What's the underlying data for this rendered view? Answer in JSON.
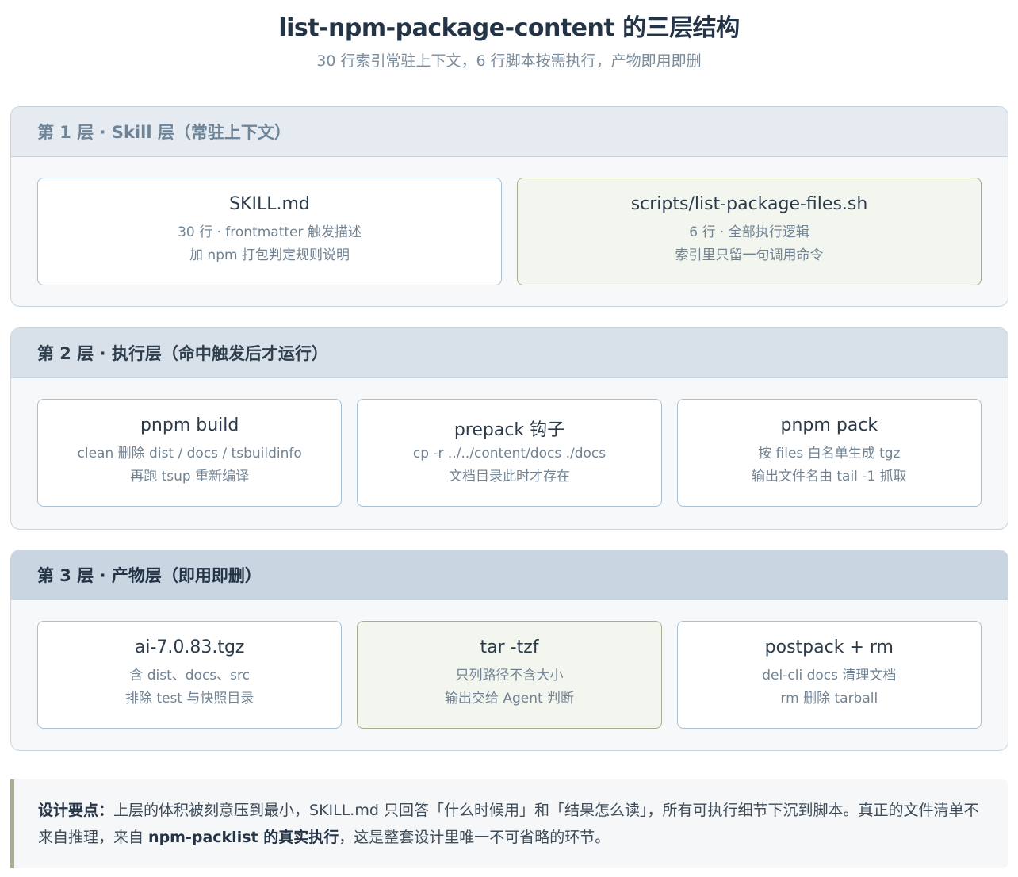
{
  "title": "list-npm-package-content 的三层结构",
  "subtitle": "30 行索引常驻上下文，6 行脚本按需执行，产物即用即删",
  "layers": [
    {
      "label": "第 1 层 · Skill 层（常驻上下文）",
      "cards": [
        {
          "title": "SKILL.md",
          "line1": "30 行 · frontmatter 触发描述",
          "line2": "加 npm 打包判定规则说明"
        },
        {
          "title": "scripts/list-package-files.sh",
          "line1": "6 行 · 全部执行逻辑",
          "line2": "索引里只留一句调用命令"
        }
      ]
    },
    {
      "label": "第 2 层 · 执行层（命中触发后才运行）",
      "cards": [
        {
          "title": "pnpm build",
          "line1": "clean 删除 dist / docs / tsbuildinfo",
          "line2": "再跑 tsup 重新编译"
        },
        {
          "title": "prepack 钩子",
          "line1": "cp -r ../../content/docs ./docs",
          "line2": "文档目录此时才存在"
        },
        {
          "title": "pnpm pack",
          "line1": "按 files 白名单生成 tgz",
          "line2": "输出文件名由 tail -1 抓取"
        }
      ]
    },
    {
      "label": "第 3 层 · 产物层（即用即删）",
      "cards": [
        {
          "title": "ai-7.0.83.tgz",
          "line1": "含 dist、docs、src",
          "line2": "排除 test 与快照目录"
        },
        {
          "title": "tar -tzf",
          "line1": "只列路径不含大小",
          "line2": "输出交给 Agent 判断"
        },
        {
          "title": "postpack + rm",
          "line1": "del-cli docs 清理文档",
          "line2": "rm 删除 tarball"
        }
      ]
    }
  ],
  "note": {
    "lead": "设计要点：",
    "text1": "上层的体积被刻意压到最小，SKILL.md 只回答「什么时候用」和「结果怎么读」，所有可执行细节下沉到脚本。真正的文件清单不来自推理，来自 ",
    "emphasis": "npm-packlist 的真实执行",
    "text2": "，这是整套设计里唯一不可省略的环节。"
  }
}
